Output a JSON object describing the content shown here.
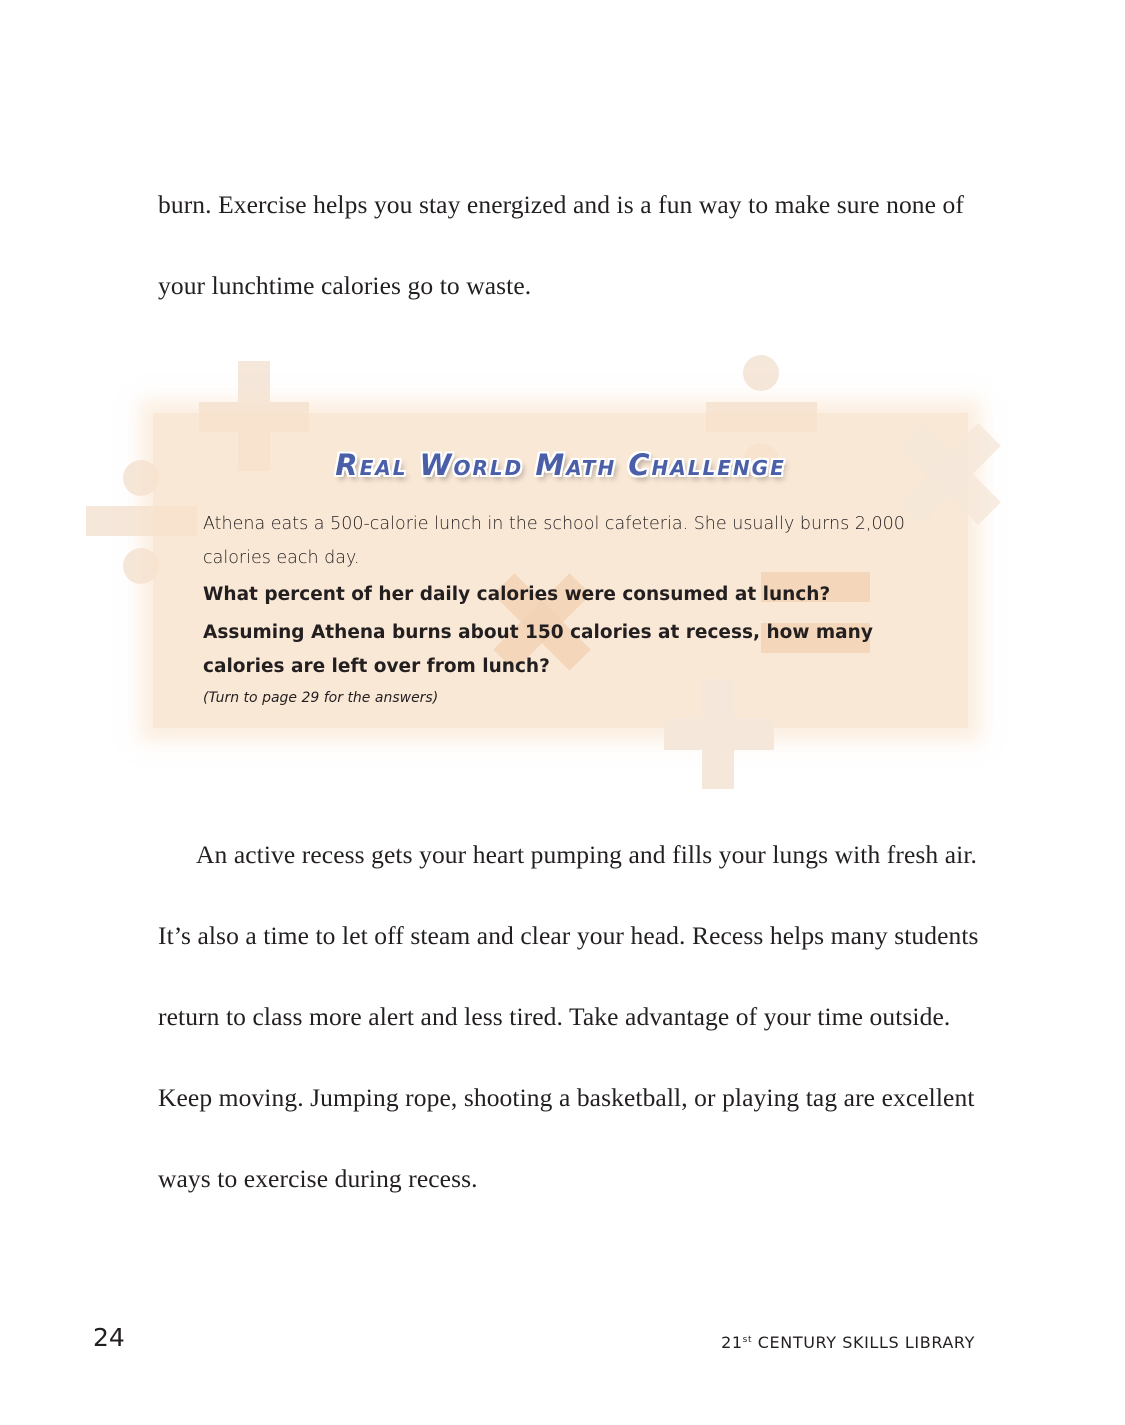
{
  "paragraphs": {
    "top": "burn. Exercise helps you stay energized and is a fun way to make sure none of your lunchtime calories go to waste.",
    "bottom": "An active recess gets your heart pumping and fills your lungs with fresh air. It’s also a time to let off steam and clear your head. Recess helps many students return to class more alert and less tired. Take advantage of your time outside. Keep moving. Jumping rope, shooting a basketball, or playing tag are excellent ways to exercise during recess."
  },
  "challenge": {
    "title": "Real World Math Challenge",
    "intro": "Athena eats a 500-calorie lunch in the school cafeteria. She usually burns 2,000 calories each day.",
    "question_1": "What percent of her daily calories were consumed at lunch?",
    "question_2": "Assuming Athena burns about 150 calories at recess, how many calories are left over from lunch?",
    "note": "(Turn to page 29 for the answers)"
  },
  "footer": {
    "page_number": "24",
    "series_prefix": "21",
    "series_sup": "st",
    "series_suffix": " CENTURY SKILLS LIBRARY"
  },
  "colors": {
    "title_blue": "#4a5fa8",
    "box_peach": "#f9e2cb",
    "symbol_tan": "#f5e7da"
  },
  "icons": [
    "plus-icon",
    "divide-icon",
    "multiply-icon",
    "equals-icon"
  ]
}
